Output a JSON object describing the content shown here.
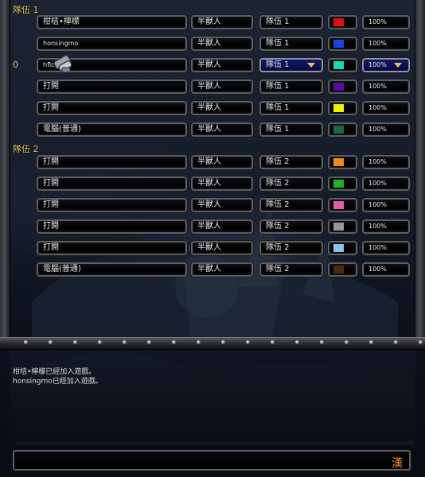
{
  "teams": [
    {
      "label": "隊伍 1",
      "slots": [
        {
          "name": "柑桔•檸檬",
          "race": "半獸人",
          "team": "隊伍 1",
          "color": "#e01010",
          "handicap": "100%",
          "slot_number": ""
        },
        {
          "name": "honsingmo",
          "race": "半獸人",
          "team": "隊伍 1",
          "color": "#1a46e0",
          "handicap": "100%",
          "slot_number": ""
        },
        {
          "name": "hflc301",
          "race": "半獸人",
          "team": "隊伍 1",
          "color": "#1ed6b0",
          "handicap": "100%",
          "slot_number": "0"
        },
        {
          "name": "打開",
          "race": "半獸人",
          "team": "隊伍 1",
          "color": "#5a0ca0",
          "handicap": "100%",
          "slot_number": ""
        },
        {
          "name": "打開",
          "race": "半獸人",
          "team": "隊伍 1",
          "color": "#f0f000",
          "handicap": "100%",
          "slot_number": ""
        },
        {
          "name": "電腦(普通)",
          "race": "半獸人",
          "team": "隊伍 1",
          "color": "#1a6a48",
          "handicap": "100%",
          "slot_number": ""
        }
      ]
    },
    {
      "label": "隊伍 2",
      "slots": [
        {
          "name": "打開",
          "race": "半獸人",
          "team": "隊伍 2",
          "color": "#f08a1a",
          "handicap": "100%",
          "slot_number": ""
        },
        {
          "name": "打開",
          "race": "半獸人",
          "team": "隊伍 2",
          "color": "#20b020",
          "handicap": "100%",
          "slot_number": ""
        },
        {
          "name": "打開",
          "race": "半獸人",
          "team": "隊伍 2",
          "color": "#e060a8",
          "handicap": "100%",
          "slot_number": ""
        },
        {
          "name": "打開",
          "race": "半獸人",
          "team": "隊伍 2",
          "color": "#9a9a9a",
          "handicap": "100%",
          "slot_number": ""
        },
        {
          "name": "打開",
          "race": "半獸人",
          "team": "隊伍 2",
          "color": "#8cc4ee",
          "handicap": "100%",
          "slot_number": ""
        },
        {
          "name": "電腦(普通)",
          "race": "半獸人",
          "team": "隊伍 2",
          "color": "#4a2a10",
          "handicap": "100%",
          "slot_number": ""
        }
      ]
    }
  ],
  "chat": {
    "messages": [
      "柑桔•檸檬已經加入遊戲。",
      "honsingmo已經加入遊戲。"
    ],
    "input_value": "",
    "ime_indicator": "漢"
  },
  "theme": {
    "label_gold": "#e8c25a",
    "selected_blue": "#141a72"
  },
  "icons": {
    "cursor": "gauntlet-cursor-icon"
  }
}
